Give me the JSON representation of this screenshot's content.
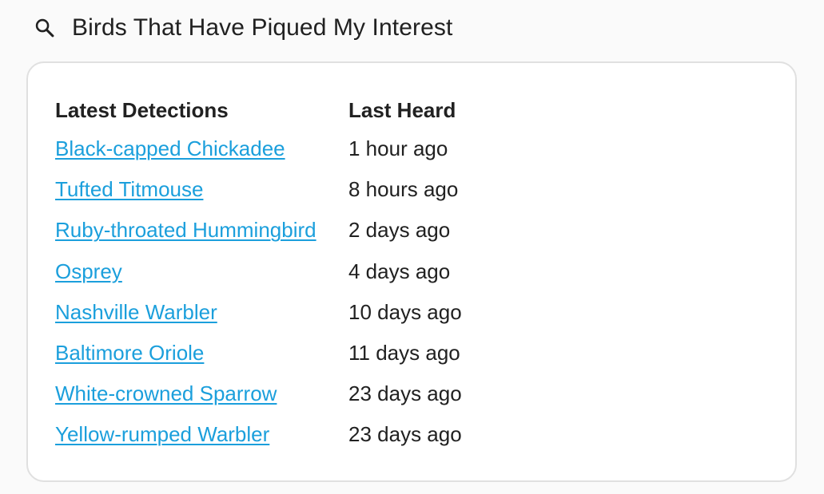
{
  "header": {
    "icon": "search-icon",
    "title": "Birds That Have Piqued My Interest"
  },
  "table": {
    "columns": [
      "Latest Detections",
      "Last Heard"
    ],
    "rows": [
      {
        "bird": "Black-capped Chickadee",
        "last_heard": "1 hour ago"
      },
      {
        "bird": "Tufted Titmouse",
        "last_heard": "8 hours ago"
      },
      {
        "bird": "Ruby-throated Hummingbird",
        "last_heard": "2 days ago"
      },
      {
        "bird": "Osprey",
        "last_heard": "4 days ago"
      },
      {
        "bird": "Nashville Warbler",
        "last_heard": "10 days ago"
      },
      {
        "bird": "Baltimore Oriole",
        "last_heard": "11 days ago"
      },
      {
        "bird": "White-crowned Sparrow",
        "last_heard": "23 days ago"
      },
      {
        "bird": "Yellow-rumped Warbler",
        "last_heard": "23 days ago"
      }
    ]
  },
  "colors": {
    "link": "#1b9fdc",
    "text": "#212121",
    "background": "#fafafa",
    "card": "#ffffff",
    "border": "#e0e0e0"
  }
}
